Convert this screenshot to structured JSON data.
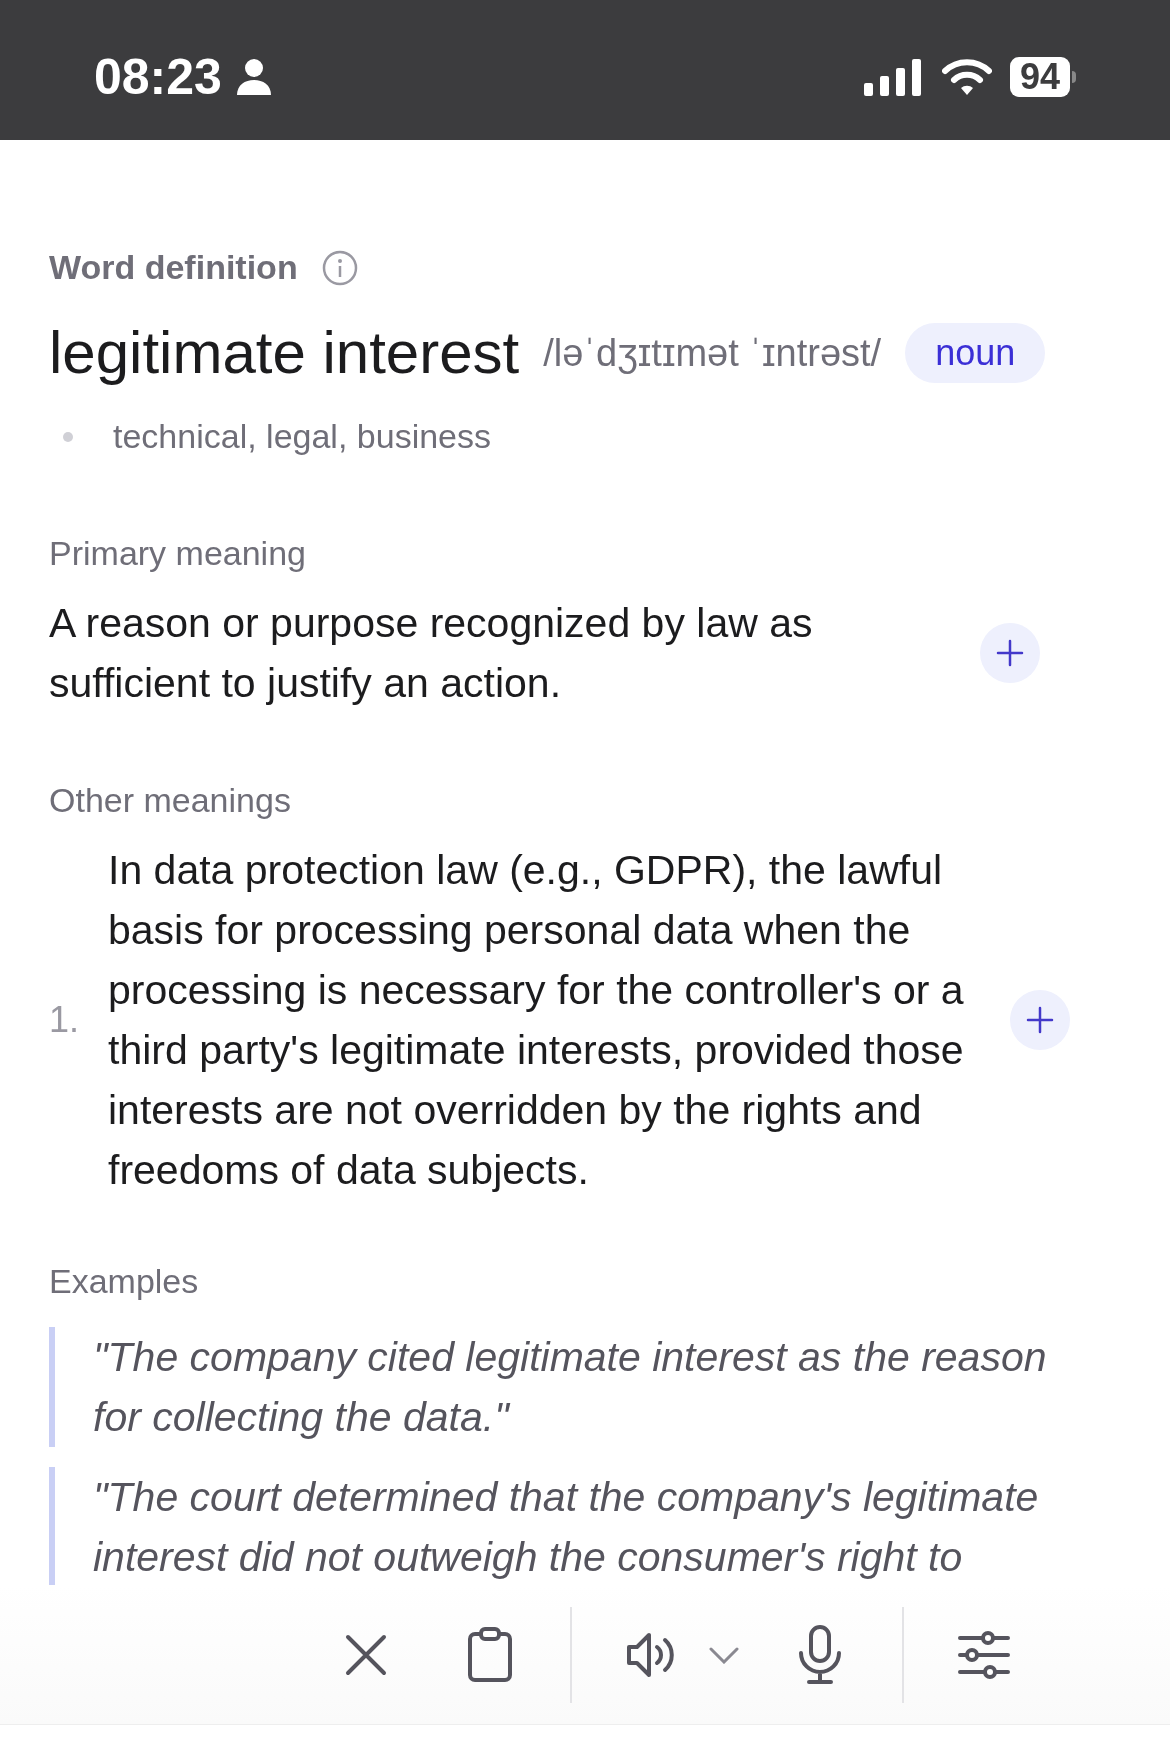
{
  "status_bar": {
    "time": "08:23",
    "battery": "94"
  },
  "definition": {
    "section_label": "Word definition",
    "word": "legitimate interest",
    "pronunciation": "/ləˈdʒɪtɪmət ˈɪntrəst/",
    "part_of_speech": "noun",
    "tags": [
      "technical, legal, business"
    ]
  },
  "primary_meaning": {
    "label": "Primary meaning",
    "text": "A reason or purpose recognized by law as sufficient to justify an action."
  },
  "other_meanings": {
    "label": "Other meanings",
    "items": [
      {
        "number": "1.",
        "text": "In data protection law (e.g., GDPR), the lawful basis for processing personal data when the processing is necessary for the controller's or a third party's legitimate interests, provided those interests are not overridden by the rights and freedoms of data subjects."
      }
    ]
  },
  "examples": {
    "label": "Examples",
    "items": [
      "\"The company cited legitimate interest as the reason for collecting the data.\"",
      "\"The court determined that the company's legitimate interest did not outweigh the consumer's right to"
    ]
  }
}
